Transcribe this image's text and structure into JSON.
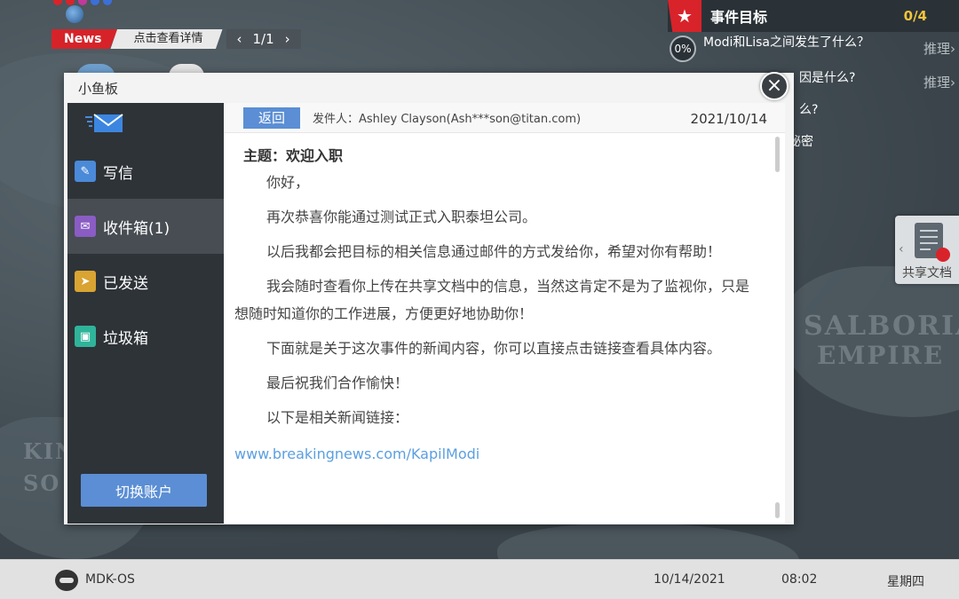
{
  "ticker": {
    "tag": "News",
    "text": "点击查看详情",
    "prev_icon": "chevron-left-icon",
    "page": "1/1",
    "next_icon": "chevron-right-icon"
  },
  "objectives": {
    "title": "事件目标",
    "count": "0/4",
    "items": [
      {
        "progress": "0%",
        "question": "Modi和Lisa之间发生了什么？",
        "action": "推理"
      },
      {
        "progress": "",
        "question": "因是什么?",
        "action": "推理"
      },
      {
        "progress": "",
        "question": "么?",
        "action": ""
      },
      {
        "progress": "",
        "question": "秘密",
        "action": ""
      }
    ]
  },
  "shared_docs": {
    "label": "共享文档"
  },
  "map_labels": [
    "SALBORIAN",
    "EMPIRE",
    "KIN",
    "SO"
  ],
  "window": {
    "title": "小鱼板",
    "sidebar": {
      "items": [
        {
          "label": "写信",
          "icon": "compose-icon",
          "color": "#4a8ad8"
        },
        {
          "label": "收件箱(1)",
          "icon": "inbox-icon",
          "color": "#8a5cc4"
        },
        {
          "label": "已发送",
          "icon": "send-icon",
          "color": "#d9a432"
        },
        {
          "label": "垃圾箱",
          "icon": "trash-icon",
          "color": "#2fb49a"
        }
      ],
      "switch_account": "切换账户"
    },
    "mail": {
      "back": "返回",
      "sender": "发件人：Ashley Clayson(Ash***son@titan.com)",
      "date": "2021/10/14",
      "subject": "主题：欢迎入职",
      "paragraphs": [
        "你好，",
        "再次恭喜你能通过测试正式入职泰坦公司。",
        "以后我都会把目标的相关信息通过邮件的方式发给你，希望对你有帮助！",
        "我会随时查看你上传在共享文档中的信息，当然这肯定不是为了监视你，只是想随时知道你的工作进展，方便更好地协助你！",
        "下面就是关于这次事件的新闻内容，你可以直接点击链接查看具体内容。",
        "最后祝我们合作愉快！",
        "以下是相关新闻链接："
      ],
      "link": "www.breakingnews.com/KapilModi"
    }
  },
  "taskbar": {
    "os": "MDK-OS",
    "date": "10/14/2021",
    "time": "08:02",
    "day": "星期四"
  },
  "colors": {
    "accent_red": "#d9232a",
    "accent_blue": "#5b8ed4",
    "count_yellow": "#f3c43a"
  }
}
